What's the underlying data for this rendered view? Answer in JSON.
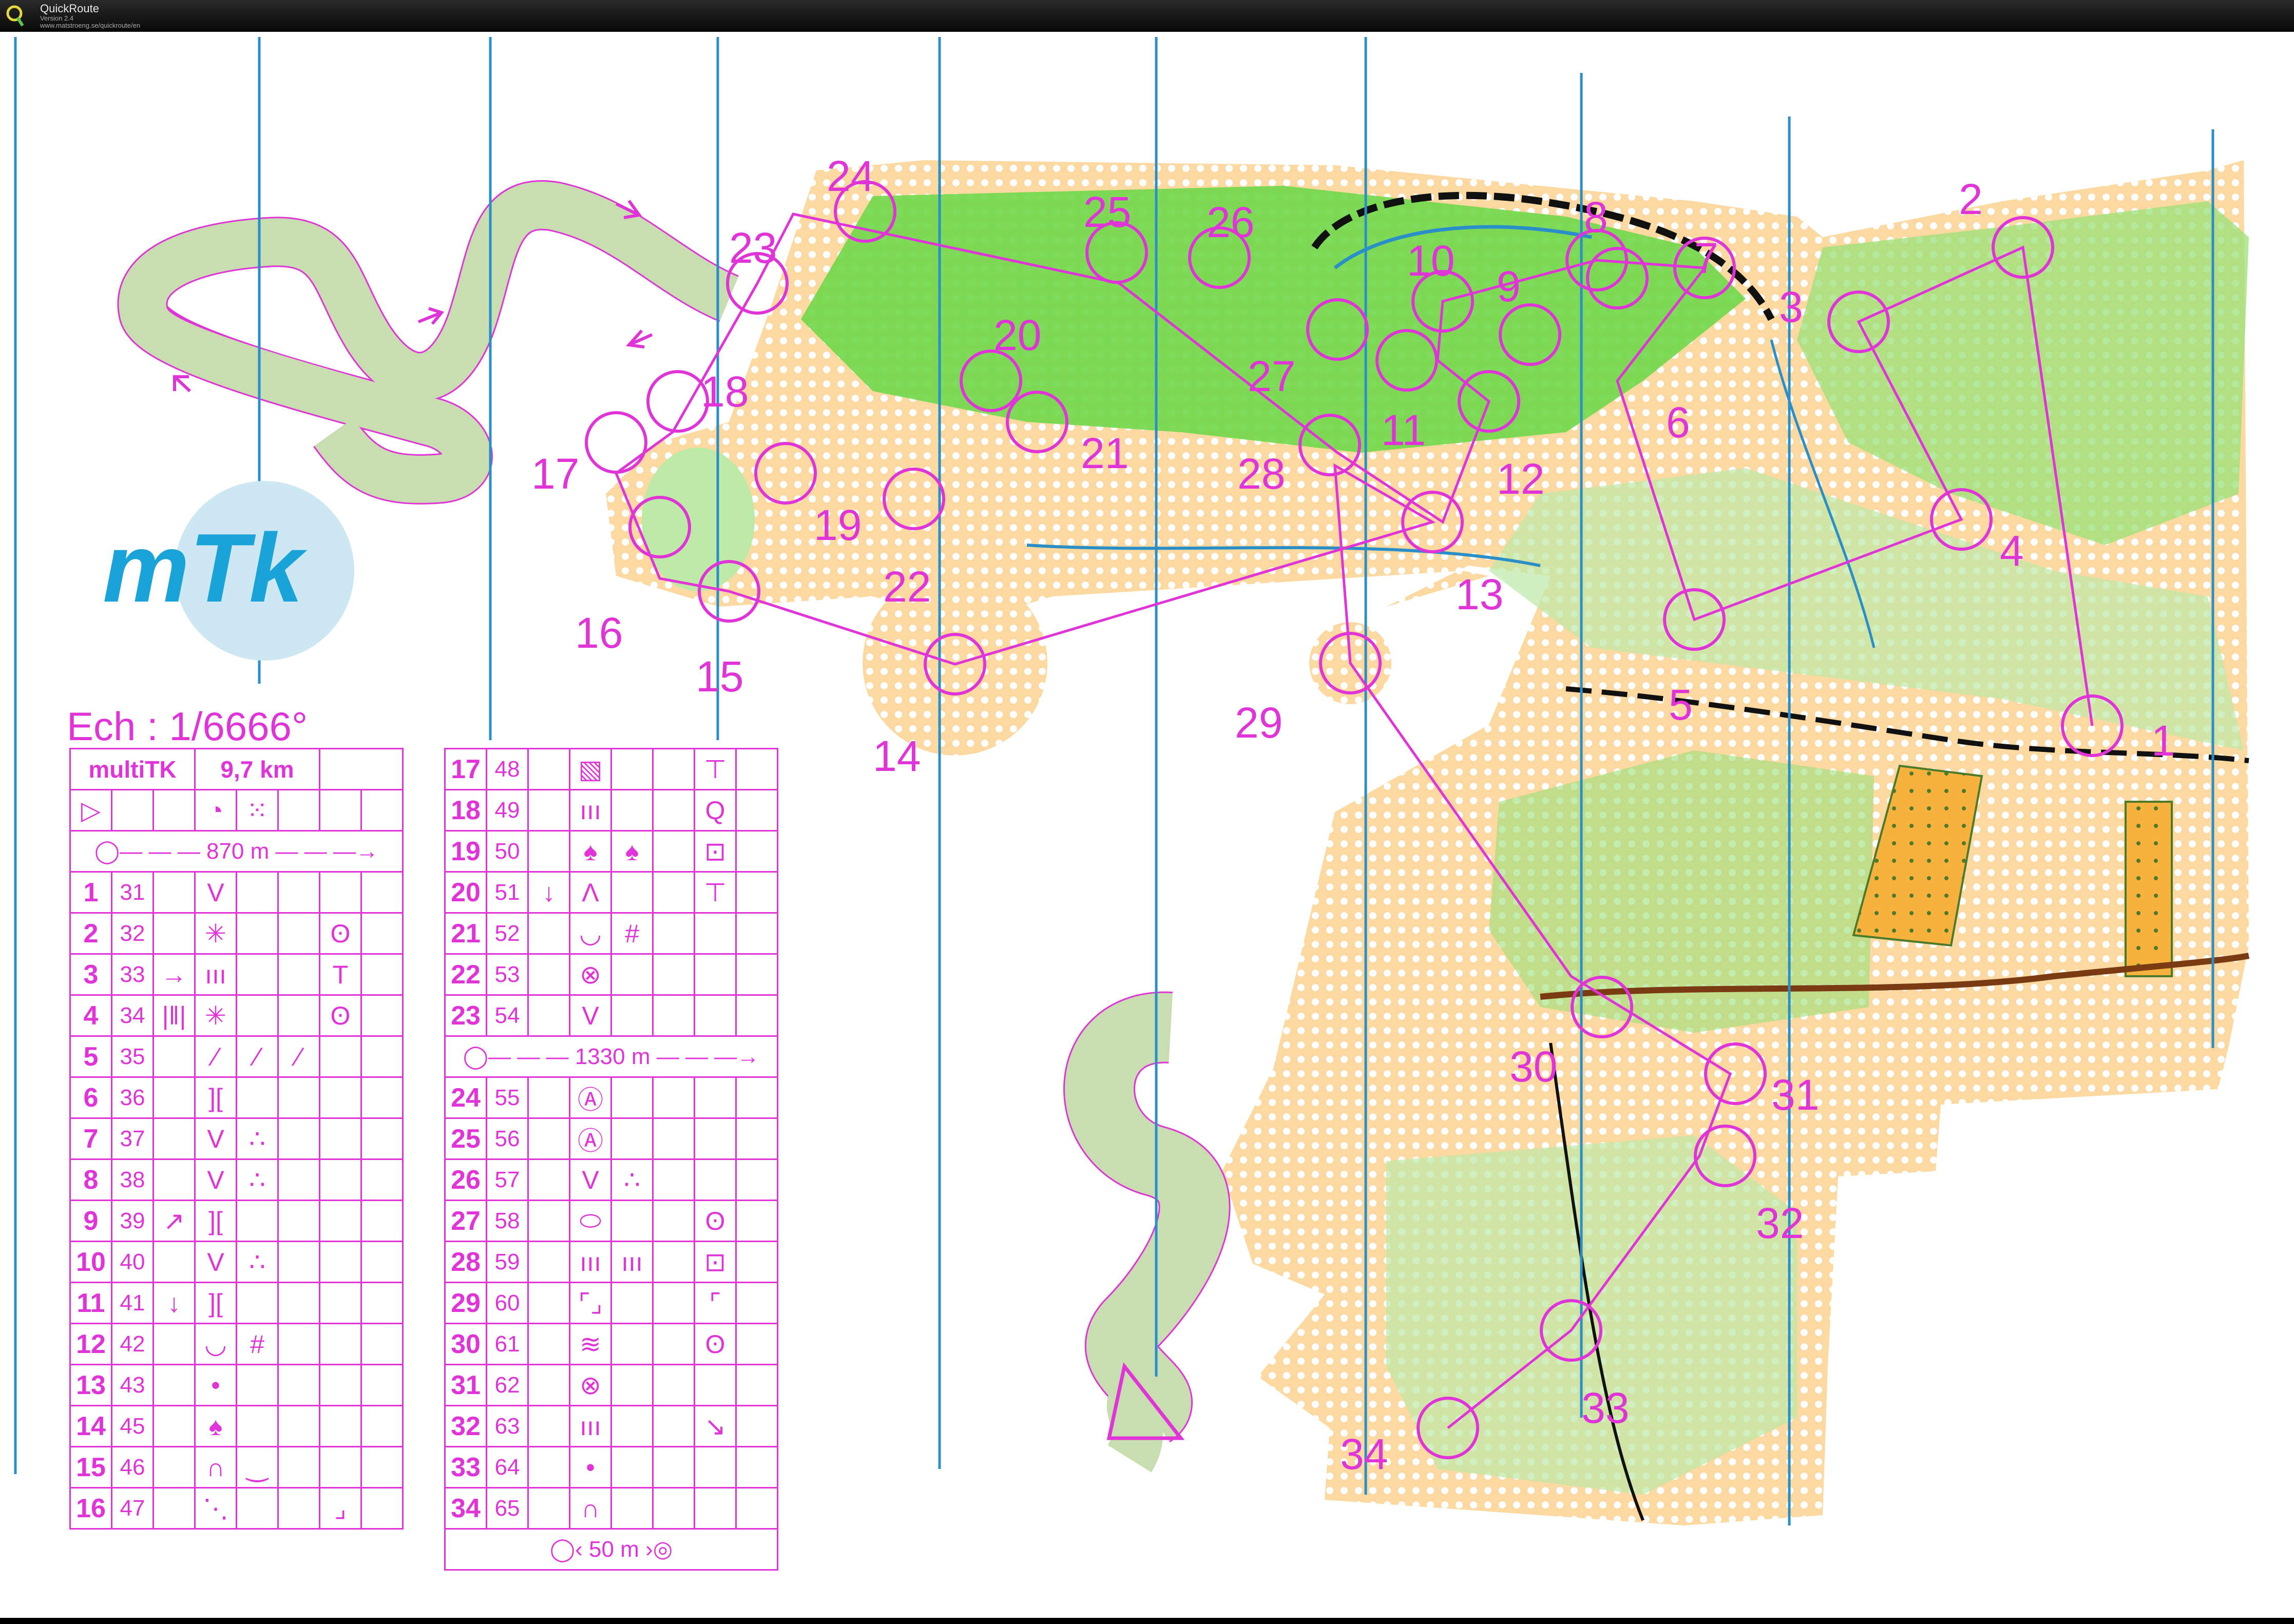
{
  "app": {
    "name": "QuickRoute",
    "version": "Version 2.4",
    "url": "www.matstroeng.se/quickroute/en"
  },
  "map": {
    "scale_label": "Ech : 1/6666°",
    "logo_text": "mTk",
    "colors": {
      "course": "#e033d8",
      "meridian": "#2a8fc8",
      "forest": "#6fd84a",
      "open": "#f5c27a",
      "rough": "#fbe5b8",
      "logo_bg": "#cde8f2",
      "logo_fg": "#1aa3d8"
    },
    "controls": [
      "1",
      "2",
      "3",
      "4",
      "5",
      "6",
      "7",
      "8",
      "9",
      "10",
      "11",
      "12",
      "13",
      "14",
      "15",
      "16",
      "17",
      "18",
      "19",
      "20",
      "21",
      "22",
      "23",
      "24",
      "25",
      "26",
      "27",
      "28",
      "29",
      "30",
      "31",
      "32",
      "33",
      "34"
    ]
  },
  "course": {
    "name": "multiTK",
    "length": "9,7 km",
    "first_leg": "870 m",
    "mid_leg": "1330 m",
    "finish_leg": "50 m",
    "left_rows": [
      {
        "n": "1",
        "code": "31",
        "c": "",
        "d": "V",
        "e": "",
        "f": "",
        "g": "",
        "h": ""
      },
      {
        "n": "2",
        "code": "32",
        "c": "",
        "d": "✳",
        "e": "",
        "f": "",
        "g": "ʘ",
        "h": ""
      },
      {
        "n": "3",
        "code": "33",
        "c": "→",
        "d": "ııı",
        "e": "",
        "f": "",
        "g": "T",
        "h": ""
      },
      {
        "n": "4",
        "code": "34",
        "c": "|ǁ|",
        "d": "✳",
        "e": "",
        "f": "",
        "g": "ʘ",
        "h": ""
      },
      {
        "n": "5",
        "code": "35",
        "c": "",
        "d": "⁄",
        "e": "⁄",
        "f": "⁄",
        "g": "",
        "h": ""
      },
      {
        "n": "6",
        "code": "36",
        "c": "",
        "d": "][",
        "e": "",
        "f": "",
        "g": "",
        "h": ""
      },
      {
        "n": "7",
        "code": "37",
        "c": "",
        "d": "V",
        "e": "∴",
        "f": "",
        "g": "",
        "h": ""
      },
      {
        "n": "8",
        "code": "38",
        "c": "",
        "d": "V",
        "e": "∴",
        "f": "",
        "g": "",
        "h": ""
      },
      {
        "n": "9",
        "code": "39",
        "c": "↗",
        "d": "][",
        "e": "",
        "f": "",
        "g": "",
        "h": ""
      },
      {
        "n": "10",
        "code": "40",
        "c": "",
        "d": "V",
        "e": "∴",
        "f": "",
        "g": "",
        "h": ""
      },
      {
        "n": "11",
        "code": "41",
        "c": "↓",
        "d": "][",
        "e": "",
        "f": "",
        "g": "",
        "h": ""
      },
      {
        "n": "12",
        "code": "42",
        "c": "",
        "d": "◡",
        "e": "#",
        "f": "",
        "g": "",
        "h": ""
      },
      {
        "n": "13",
        "code": "43",
        "c": "",
        "d": "•",
        "e": "",
        "f": "",
        "g": "",
        "h": ""
      },
      {
        "n": "14",
        "code": "45",
        "c": "",
        "d": "♠",
        "e": "",
        "f": "",
        "g": "",
        "h": ""
      },
      {
        "n": "15",
        "code": "46",
        "c": "",
        "d": "∩",
        "e": "‿",
        "f": "",
        "g": "",
        "h": ""
      },
      {
        "n": "16",
        "code": "47",
        "c": "",
        "d": "⋱",
        "e": "",
        "f": "",
        "g": "⌟",
        "h": ""
      }
    ],
    "right_rows_a": [
      {
        "n": "17",
        "code": "48",
        "c": "",
        "d": "▧",
        "e": "",
        "f": "",
        "g": "⊤",
        "h": ""
      },
      {
        "n": "18",
        "code": "49",
        "c": "",
        "d": "ııı",
        "e": "",
        "f": "",
        "g": "Q",
        "h": ""
      },
      {
        "n": "19",
        "code": "50",
        "c": "",
        "d": "♠",
        "e": "♠",
        "f": "",
        "g": "⊡",
        "h": ""
      },
      {
        "n": "20",
        "code": "51",
        "c": "↓",
        "d": "Λ",
        "e": "",
        "f": "",
        "g": "⊤",
        "h": ""
      },
      {
        "n": "21",
        "code": "52",
        "c": "",
        "d": "◡",
        "e": "#",
        "f": "",
        "g": "",
        "h": ""
      },
      {
        "n": "22",
        "code": "53",
        "c": "",
        "d": "⊗",
        "e": "",
        "f": "",
        "g": "",
        "h": ""
      },
      {
        "n": "23",
        "code": "54",
        "c": "",
        "d": "V",
        "e": "",
        "f": "",
        "g": "",
        "h": ""
      }
    ],
    "right_rows_b": [
      {
        "n": "24",
        "code": "55",
        "c": "",
        "d": "Ⓐ",
        "e": "",
        "f": "",
        "g": "",
        "h": ""
      },
      {
        "n": "25",
        "code": "56",
        "c": "",
        "d": "Ⓐ",
        "e": "",
        "f": "",
        "g": "",
        "h": ""
      },
      {
        "n": "26",
        "code": "57",
        "c": "",
        "d": "V",
        "e": "∴",
        "f": "",
        "g": "",
        "h": ""
      },
      {
        "n": "27",
        "code": "58",
        "c": "",
        "d": "⬭",
        "e": "",
        "f": "",
        "g": "ʘ",
        "h": ""
      },
      {
        "n": "28",
        "code": "59",
        "c": "",
        "d": "ııı",
        "e": "ııı",
        "f": "",
        "g": "⊡",
        "h": ""
      },
      {
        "n": "29",
        "code": "60",
        "c": "",
        "d": "⌜⌟",
        "e": "",
        "f": "",
        "g": "⌜",
        "h": ""
      },
      {
        "n": "30",
        "code": "61",
        "c": "",
        "d": "≋",
        "e": "",
        "f": "",
        "g": "ʘ",
        "h": ""
      },
      {
        "n": "31",
        "code": "62",
        "c": "",
        "d": "⊗",
        "e": "",
        "f": "",
        "g": "",
        "h": ""
      },
      {
        "n": "32",
        "code": "63",
        "c": "",
        "d": "ııı",
        "e": "",
        "f": "",
        "g": "↘",
        "h": ""
      },
      {
        "n": "33",
        "code": "64",
        "c": "",
        "d": "•",
        "e": "",
        "f": "",
        "g": "",
        "h": ""
      },
      {
        "n": "34",
        "code": "65",
        "c": "",
        "d": "∩",
        "e": "",
        "f": "",
        "g": "",
        "h": ""
      }
    ]
  }
}
